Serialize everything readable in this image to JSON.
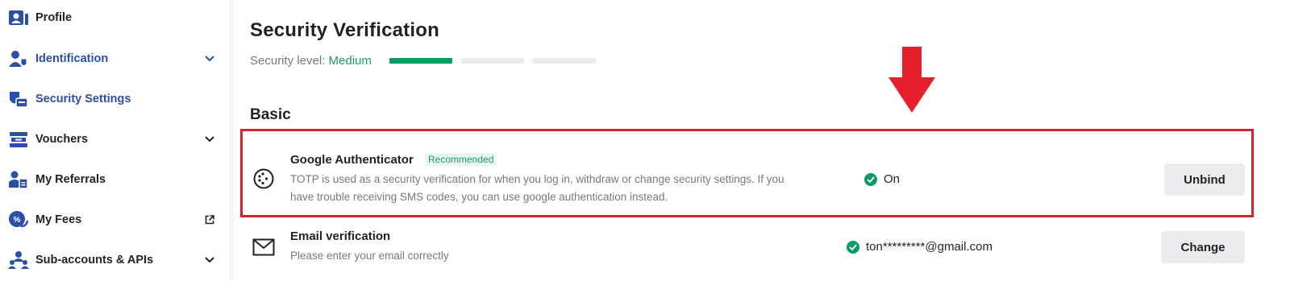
{
  "sidebar": {
    "items": [
      {
        "label": "Profile",
        "icon": "profile-icon"
      },
      {
        "label": "Identification",
        "icon": "identification-icon"
      },
      {
        "label": "Security Settings",
        "icon": "security-icon"
      },
      {
        "label": "Vouchers",
        "icon": "voucher-icon"
      },
      {
        "label": "My Referrals",
        "icon": "referrals-icon"
      },
      {
        "label": "My Fees",
        "icon": "fees-icon"
      },
      {
        "label": "Sub-accounts & APIs",
        "icon": "sub-accounts-icon"
      }
    ]
  },
  "main": {
    "title": "Security Verification",
    "security_level_label": "Security level:",
    "security_level_value": "Medium",
    "section_basic": "Basic",
    "methods": [
      {
        "title": "Google Authenticator",
        "badge": "Recommended",
        "description": "TOTP is used as a security verification for when you log in, withdraw or change security settings. If you have trouble receiving SMS codes, you can use google authentication instead.",
        "status": "On",
        "action": "Unbind"
      },
      {
        "title": "Email verification",
        "description": "Please enter your email correctly",
        "status": "ton*********@gmail.com",
        "action": "Change"
      }
    ]
  },
  "colors": {
    "accent_green": "#0b9b63",
    "highlight_red": "#d9202b",
    "nav_blue": "#2b4fa8"
  }
}
